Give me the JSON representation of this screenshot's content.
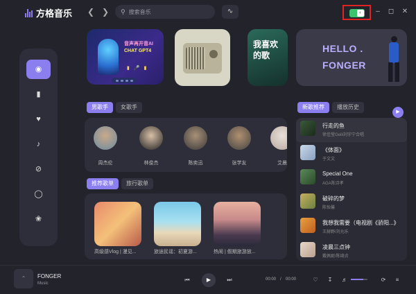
{
  "app": {
    "title": "方格音乐"
  },
  "search": {
    "placeholder": "搜索音乐"
  },
  "banners": {
    "b1_line1": "音声再开音AI",
    "b1_line2": "CHAT GPT4",
    "b3_text": "我喜欢的歌",
    "hello_line1": "HELLO .",
    "hello_line2": "FONGER"
  },
  "singer_tabs": [
    "男歌手",
    "女歌手"
  ],
  "singers": [
    "周杰伦",
    "林俊杰",
    "陈奕迅",
    "张学友",
    "艾晨"
  ],
  "playlist_tabs": [
    "推荐歌单",
    "旅行歌单"
  ],
  "playlists": [
    "高级感Vlog | 漫见...",
    "旅途民谣：初夏游...",
    "热闹 | 假期旅游放..."
  ],
  "list_tabs": [
    "新歌推荐",
    "播放历史"
  ],
  "songs": [
    {
      "title": "行走的鱼",
      "artist": "徐佳莹Geili刘宇宁合唱"
    },
    {
      "title": "《体面》",
      "artist": "于文文"
    },
    {
      "title": "Special One",
      "artist": "AGA陈诗孝"
    },
    {
      "title": "破碎的梦",
      "artist": "陈怡馨"
    },
    {
      "title": "我想我需要（电视剧《骄阳...》",
      "artist": "王赫野/刘允乐"
    },
    {
      "title": "凌晨三点钟",
      "artist": "戴佩妮/陈绮贞"
    }
  ],
  "player": {
    "name": "FONGER",
    "sub": "Music",
    "current": "00:00",
    "total": "00:00",
    "volume_fraction": 0.75
  },
  "colors": {
    "accent": "#8b7ff0",
    "theme_toggle": "#3bc46d",
    "highlight_box": "#e02424"
  }
}
